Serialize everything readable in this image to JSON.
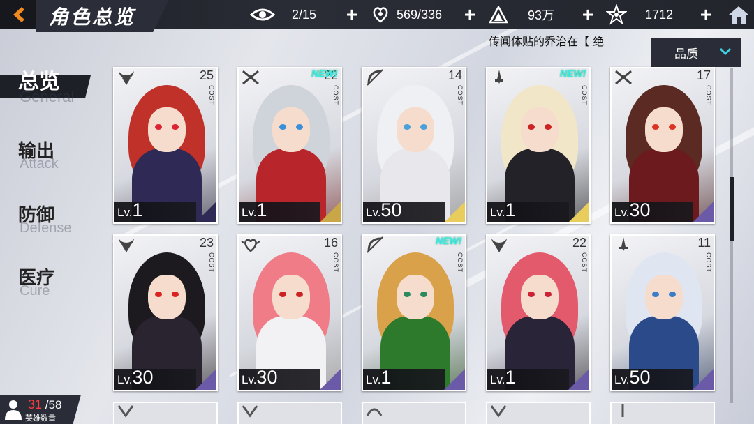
{
  "header": {
    "title": "角色总览",
    "resources": [
      {
        "icon": "eye-icon",
        "value": "2/15"
      },
      {
        "icon": "heart-hand-icon",
        "value": "569/336"
      },
      {
        "icon": "mountain-crest-icon",
        "value": "93万"
      },
      {
        "icon": "star-badge-icon",
        "value": "1712"
      }
    ]
  },
  "marquee": {
    "text": "传闻体贴的乔治在【 绝"
  },
  "filter": {
    "label": "品质"
  },
  "sidebar": {
    "items": [
      {
        "cn": "总览",
        "en": "General"
      },
      {
        "cn": "输出",
        "en": "Attack"
      },
      {
        "cn": "防御",
        "en": "Defense"
      },
      {
        "cn": "医疗",
        "en": "Cure"
      }
    ]
  },
  "lv_prefix": "Lv.",
  "cost_label": "COST",
  "new_label": "NEW!",
  "cards": [
    {
      "cost": "25",
      "level": "1",
      "new": false,
      "class_icon": "horned-helmet-icon",
      "hair": "#c0312a",
      "outfit": "#2f2a55",
      "eyes": "#d23",
      "tri": "#2f2a55"
    },
    {
      "cost": "22",
      "level": "1",
      "new": true,
      "class_icon": "crossed-swords-icon",
      "hair": "#cfd3da",
      "outfit": "#b8262c",
      "eyes": "#3a8fd8",
      "tri": "#c9a646"
    },
    {
      "cost": "14",
      "level": "50",
      "new": false,
      "class_icon": "bow-arrow-icon",
      "hair": "#eef0f3",
      "outfit": "#e7e7ec",
      "eyes": "#4aa0d8",
      "tri": "#e8cc5c"
    },
    {
      "cost": "",
      "level": "1",
      "new": true,
      "class_icon": "dagger-icon",
      "hair": "#f1e6c7",
      "outfit": "#222228",
      "eyes": "#c22",
      "tri": "#e8cc5c"
    },
    {
      "cost": "17",
      "level": "30",
      "new": false,
      "class_icon": "crossed-swords-icon",
      "hair": "#5b2a22",
      "outfit": "#6c1a1e",
      "eyes": "#d32",
      "tri": "#6a5aa8"
    },
    {
      "cost": "23",
      "level": "30",
      "new": false,
      "class_icon": "horned-helmet-icon",
      "hair": "#1c1a1f",
      "outfit": "#2a2430",
      "eyes": "#d22",
      "tri": "#6a5aa8"
    },
    {
      "cost": "16",
      "level": "30",
      "new": false,
      "class_icon": "heart-wings-icon",
      "hair": "#f07c88",
      "outfit": "#f2f2f4",
      "eyes": "#c22",
      "tri": "#6a5aa8"
    },
    {
      "cost": "",
      "level": "1",
      "new": true,
      "class_icon": "bow-arrow-icon",
      "hair": "#d9a24a",
      "outfit": "#2e7a2c",
      "eyes": "#2b8a5e",
      "tri": "#6a5aa8"
    },
    {
      "cost": "22",
      "level": "1",
      "new": false,
      "class_icon": "horned-helmet-icon",
      "hair": "#e25a6c",
      "outfit": "#2a2438",
      "eyes": "#c23",
      "tri": "#6a5aa8"
    },
    {
      "cost": "11",
      "level": "50",
      "new": false,
      "class_icon": "dagger-icon",
      "hair": "#dfe6f2",
      "outfit": "#2a4a8a",
      "eyes": "#3a7cc8",
      "tri": "#6a5aa8"
    }
  ],
  "hero_count": {
    "current": "31",
    "total": "/58",
    "label": "英雄数量"
  }
}
